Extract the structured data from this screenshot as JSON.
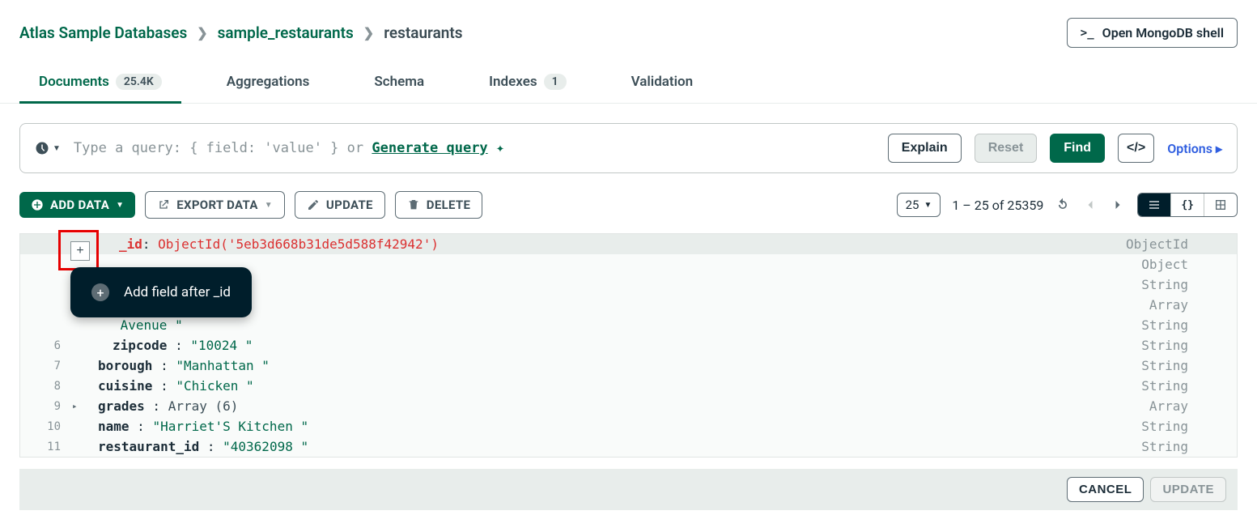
{
  "breadcrumbs": [
    "Atlas Sample Databases",
    "sample_restaurants",
    "restaurants"
  ],
  "open_shell": "Open MongoDB shell",
  "tabs": [
    {
      "label": "Documents",
      "badge": "25.4K",
      "active": true
    },
    {
      "label": "Aggregations",
      "badge": null,
      "active": false
    },
    {
      "label": "Schema",
      "badge": null,
      "active": false
    },
    {
      "label": "Indexes",
      "badge": "1",
      "active": false
    },
    {
      "label": "Validation",
      "badge": null,
      "active": false
    }
  ],
  "query": {
    "placeholder_pre": "Type a query: { field: 'value' } or ",
    "generate": "Generate query",
    "explain": "Explain",
    "reset": "Reset",
    "find": "Find",
    "options": "Options"
  },
  "actions": {
    "add_data": "ADD DATA",
    "export_data": "EXPORT DATA",
    "update": "UPDATE",
    "delete": "DELETE"
  },
  "pagination": {
    "page_size": "25",
    "range": "1 – 25 of 25359"
  },
  "tooltip": "Add field after _id",
  "doc_lines": [
    {
      "n": "",
      "indent": 0,
      "tw": "",
      "key": "_id",
      "sep": ": ",
      "val": "ObjectId('5eb3d668b31de5d588f42942')",
      "type": "ObjectId",
      "sel": true,
      "id": true
    },
    {
      "n": "",
      "indent": 0,
      "tw": "",
      "key": "",
      "sep": "",
      "val": "",
      "type": "Object"
    },
    {
      "n": "",
      "indent": 0,
      "tw": "",
      "key": "",
      "sep": "",
      "val": "",
      "type": "String"
    },
    {
      "n": "",
      "indent": 0,
      "tw": "",
      "key": "",
      "sep": "",
      "val": "",
      "type": "Array"
    },
    {
      "n": "",
      "indent": 2,
      "tw": "",
      "key": "",
      "sep": "",
      "val": " Avenue \"",
      "type": "String",
      "valonly": true
    },
    {
      "n": "6",
      "indent": 2,
      "tw": "",
      "key": "zipcode",
      "sep": " : ",
      "val": "\"10024 \"",
      "type": "String"
    },
    {
      "n": "7",
      "indent": 1,
      "tw": "",
      "key": "borough",
      "sep": " : ",
      "val": "\"Manhattan \"",
      "type": "String"
    },
    {
      "n": "8",
      "indent": 1,
      "tw": "",
      "key": "cuisine",
      "sep": " : ",
      "val": "\"Chicken \"",
      "type": "String"
    },
    {
      "n": "9",
      "indent": 1,
      "tw": "▸",
      "key": "grades",
      "sep": " : ",
      "val": "Array (6)",
      "type": "Array",
      "obj": true
    },
    {
      "n": "10",
      "indent": 1,
      "tw": "",
      "key": "name",
      "sep": " : ",
      "val": "\"Harriet'S Kitchen \"",
      "type": "String"
    },
    {
      "n": "11",
      "indent": 1,
      "tw": "",
      "key": "restaurant_id",
      "sep": " : ",
      "val": "\"40362098 \"",
      "type": "String"
    }
  ],
  "footer": {
    "cancel": "CANCEL",
    "update": "UPDATE"
  }
}
